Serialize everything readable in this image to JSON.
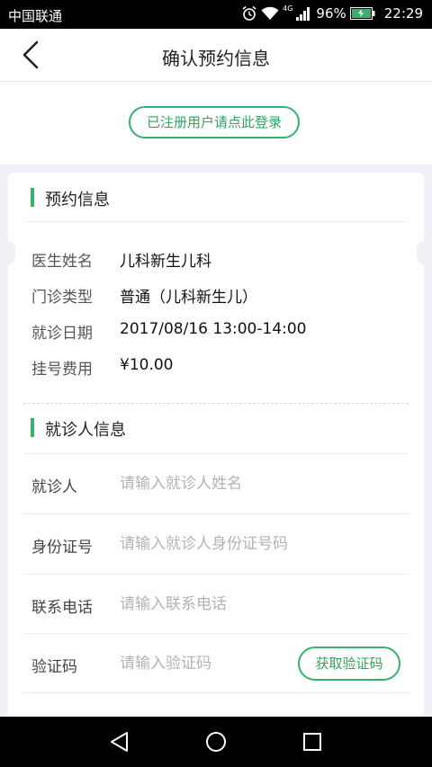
{
  "status_bar": {
    "carrier": "中国联通",
    "network": "4G",
    "battery_percent": "96%",
    "time": "22:29",
    "icons": [
      "alarm-icon",
      "wifi-icon",
      "signal-icon",
      "battery-icon"
    ]
  },
  "header": {
    "title": "确认预约信息",
    "back_icon": "chevron-left-icon"
  },
  "login": {
    "label": "已注册用户请点此登录"
  },
  "appointment": {
    "section_title": "预约信息",
    "rows": [
      {
        "label": "医生姓名",
        "value": "儿科新生儿科"
      },
      {
        "label": "门诊类型",
        "value": "普通（儿科新生儿）"
      },
      {
        "label": "就诊日期",
        "value": "2017/08/16 13:00-14:00"
      },
      {
        "label": "挂号费用",
        "value": "¥10.00"
      }
    ]
  },
  "patient": {
    "section_title": "就诊人信息",
    "fields": [
      {
        "label": "就诊人",
        "value": "",
        "placeholder": "请输入就诊人姓名"
      },
      {
        "label": "身份证号",
        "value": "",
        "placeholder": "请输入就诊人身份证号码"
      },
      {
        "label": "联系电话",
        "value": "",
        "placeholder": "请输入联系电话"
      },
      {
        "label": "验证码",
        "value": "",
        "placeholder": "请输入验证码"
      }
    ],
    "get_code_label": "获取验证码"
  },
  "colors": {
    "accent": "#3ab06f",
    "background": "#eff1f6"
  },
  "android_nav": {
    "icons": [
      "back-triangle-icon",
      "home-circle-icon",
      "recents-square-icon"
    ]
  }
}
